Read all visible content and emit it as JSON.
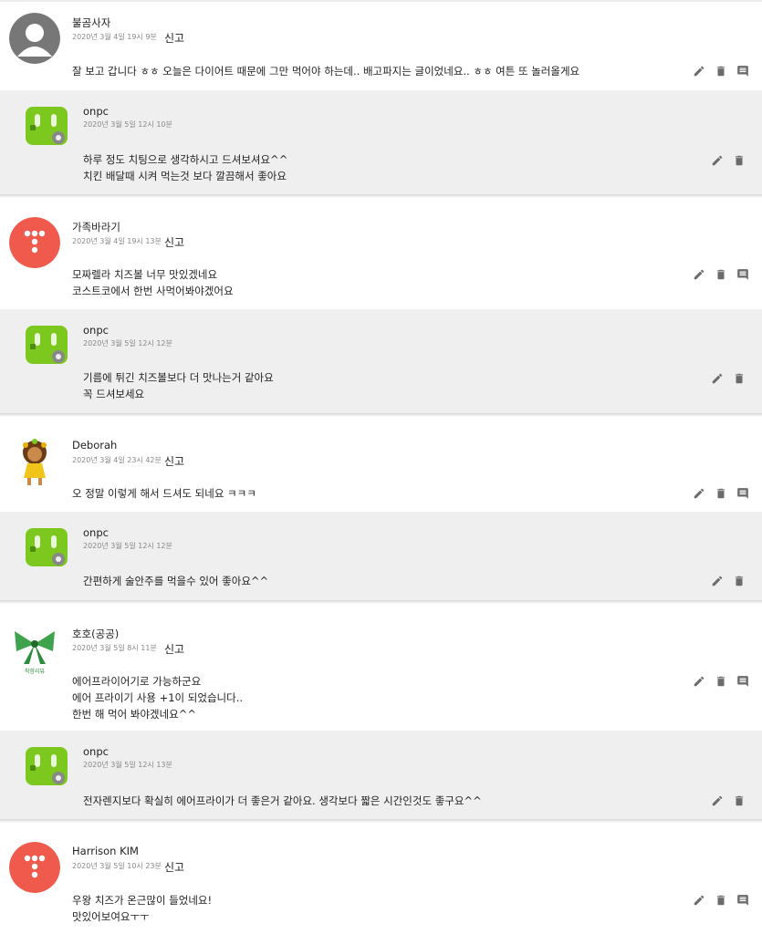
{
  "report_label": "신고",
  "comments": [
    {
      "author": "불곰사자",
      "date": "2020년 3월 4일 19시 9분",
      "lines": [
        "잘 보고 갑니다 ㅎㅎ 오늘은 다이어트 때문에 그만 먹어야 하는데.. 배고파지는 글이었네요.. ㅎㅎ 여튼 또 놀러올게요"
      ],
      "avatar": "default-person",
      "reply": {
        "author": "onpc",
        "date": "2020년 3월 5일 12시 10분",
        "lines": [
          "하루 정도 치팅으로 생각하시고 드셔보셔요^^",
          "치킨 배달때 시켜 먹는것 보다 깔끔해서 좋아요"
        ]
      }
    },
    {
      "author": "가족바라기",
      "date": "2020년 3월 4일 19시 13분",
      "lines": [
        "모짜렐라 치즈볼 너무 맛있겠네요",
        "코스트코에서 한번 사먹어봐야겠어요"
      ],
      "avatar": "red-dots",
      "reply": {
        "author": "onpc",
        "date": "2020년 3월 5일 12시 12분",
        "lines": [
          "기름에 튀긴 치즈볼보다 더 맛나는거 같아요",
          "꼭 드셔보세요"
        ]
      }
    },
    {
      "author": "Deborah",
      "date": "2020년 3월 4일 23시 42분",
      "lines": [
        "오 정말 이렇게 해서 드셔도 되네요 ㅋㅋㅋ"
      ],
      "avatar": "cartoon-girl",
      "reply": {
        "author": "onpc",
        "date": "2020년 3월 5일 12시 12분",
        "lines": [
          "간편하게 술안주를 먹을수 있어 좋아요^^"
        ]
      }
    },
    {
      "author": "호호(공공)",
      "date": "2020년 3월 5일 8시 11분",
      "lines": [
        "에어프라이어기로 가능하군요",
        "에어 프라이기 사용 +1이 되었습니다..",
        "한번 해 먹어 봐야겠네요^^"
      ],
      "avatar": "green-ribbon",
      "avatar_caption": "착함리뷰",
      "reply": {
        "author": "onpc",
        "date": "2020년 3월 5일 12시 13분",
        "lines": [
          "전자렌지보다 확실히 에어프라이가 더 좋은거 같아요. 생각보다 짧은 시간인것도 좋구요^^"
        ]
      }
    },
    {
      "author": "Harrison KIM",
      "date": "2020년 3월 5일 10시 23분",
      "lines": [
        "우왕 치즈가 온근많이 들었네요!",
        "맛있어보여요ㅜㅜ"
      ],
      "avatar": "red-dots"
    }
  ],
  "icons": {
    "edit": "pencil-icon",
    "delete": "trash-icon",
    "reply": "comment-icon"
  },
  "colors": {
    "reply_bg": "#efefef",
    "icon": "#6b6b6b",
    "red_avatar": "#ef5a4c",
    "green_avatar": "#7cc81e"
  }
}
